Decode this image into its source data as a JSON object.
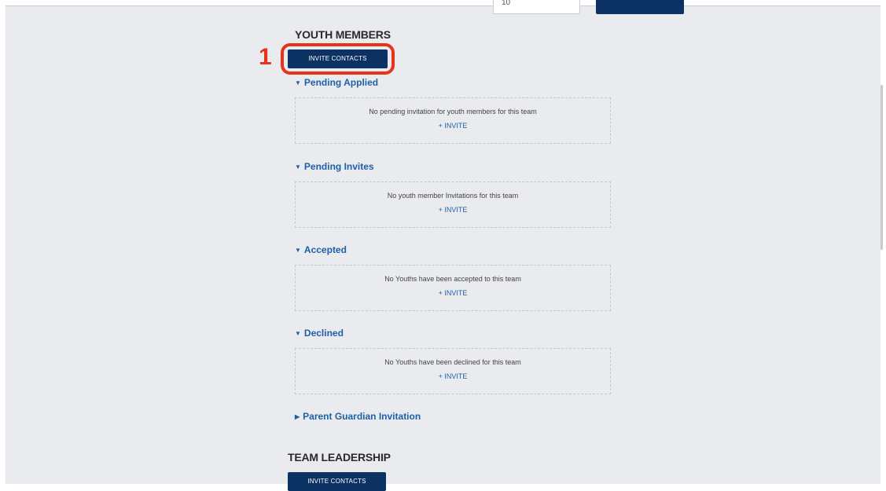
{
  "top": {
    "input_value": "10"
  },
  "annotation": {
    "number": "1"
  },
  "youth": {
    "title": "YOUTH MEMBERS",
    "invite_label": "INVITE CONTACTS",
    "groups": [
      {
        "label": "Pending Applied",
        "expanded": true,
        "message": "No pending invitation for youth members for this team",
        "invite": "+ INVITE"
      },
      {
        "label": "Pending Invites",
        "expanded": true,
        "message": "No youth member Invitations for this team",
        "invite": "+ INVITE"
      },
      {
        "label": "Accepted",
        "expanded": true,
        "message": "No Youths have been accepted to this team",
        "invite": "+ INVITE"
      },
      {
        "label": "Declined",
        "expanded": true,
        "message": "No Youths have been declined for this team",
        "invite": "+ INVITE"
      },
      {
        "label": "Parent Guardian Invitation",
        "expanded": false
      }
    ]
  },
  "leadership": {
    "title": "TEAM LEADERSHIP",
    "invite_label": "INVITE CONTACTS"
  },
  "colors": {
    "primary": "#0b3262",
    "link": "#1f5fa6",
    "annotation": "#e8331c",
    "background": "#e9ebef"
  }
}
